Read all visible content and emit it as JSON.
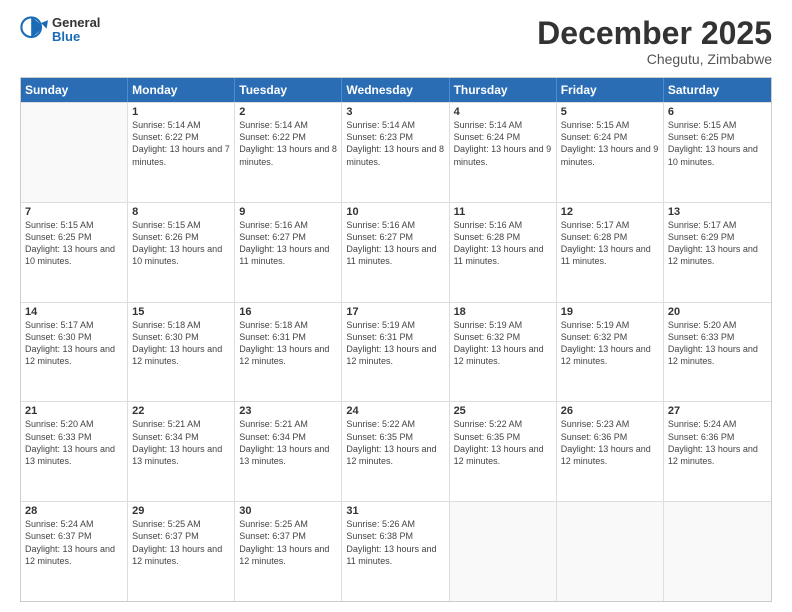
{
  "logo": {
    "general": "General",
    "blue": "Blue"
  },
  "header": {
    "month": "December 2025",
    "location": "Chegutu, Zimbabwe"
  },
  "days_of_week": [
    "Sunday",
    "Monday",
    "Tuesday",
    "Wednesday",
    "Thursday",
    "Friday",
    "Saturday"
  ],
  "weeks": [
    [
      {
        "day": "",
        "empty": true
      },
      {
        "day": "1",
        "sunrise": "Sunrise: 5:14 AM",
        "sunset": "Sunset: 6:22 PM",
        "daylight": "Daylight: 13 hours and 7 minutes."
      },
      {
        "day": "2",
        "sunrise": "Sunrise: 5:14 AM",
        "sunset": "Sunset: 6:22 PM",
        "daylight": "Daylight: 13 hours and 8 minutes."
      },
      {
        "day": "3",
        "sunrise": "Sunrise: 5:14 AM",
        "sunset": "Sunset: 6:23 PM",
        "daylight": "Daylight: 13 hours and 8 minutes."
      },
      {
        "day": "4",
        "sunrise": "Sunrise: 5:14 AM",
        "sunset": "Sunset: 6:24 PM",
        "daylight": "Daylight: 13 hours and 9 minutes."
      },
      {
        "day": "5",
        "sunrise": "Sunrise: 5:15 AM",
        "sunset": "Sunset: 6:24 PM",
        "daylight": "Daylight: 13 hours and 9 minutes."
      },
      {
        "day": "6",
        "sunrise": "Sunrise: 5:15 AM",
        "sunset": "Sunset: 6:25 PM",
        "daylight": "Daylight: 13 hours and 10 minutes."
      }
    ],
    [
      {
        "day": "7",
        "sunrise": "Sunrise: 5:15 AM",
        "sunset": "Sunset: 6:25 PM",
        "daylight": "Daylight: 13 hours and 10 minutes."
      },
      {
        "day": "8",
        "sunrise": "Sunrise: 5:15 AM",
        "sunset": "Sunset: 6:26 PM",
        "daylight": "Daylight: 13 hours and 10 minutes."
      },
      {
        "day": "9",
        "sunrise": "Sunrise: 5:16 AM",
        "sunset": "Sunset: 6:27 PM",
        "daylight": "Daylight: 13 hours and 11 minutes."
      },
      {
        "day": "10",
        "sunrise": "Sunrise: 5:16 AM",
        "sunset": "Sunset: 6:27 PM",
        "daylight": "Daylight: 13 hours and 11 minutes."
      },
      {
        "day": "11",
        "sunrise": "Sunrise: 5:16 AM",
        "sunset": "Sunset: 6:28 PM",
        "daylight": "Daylight: 13 hours and 11 minutes."
      },
      {
        "day": "12",
        "sunrise": "Sunrise: 5:17 AM",
        "sunset": "Sunset: 6:28 PM",
        "daylight": "Daylight: 13 hours and 11 minutes."
      },
      {
        "day": "13",
        "sunrise": "Sunrise: 5:17 AM",
        "sunset": "Sunset: 6:29 PM",
        "daylight": "Daylight: 13 hours and 12 minutes."
      }
    ],
    [
      {
        "day": "14",
        "sunrise": "Sunrise: 5:17 AM",
        "sunset": "Sunset: 6:30 PM",
        "daylight": "Daylight: 13 hours and 12 minutes."
      },
      {
        "day": "15",
        "sunrise": "Sunrise: 5:18 AM",
        "sunset": "Sunset: 6:30 PM",
        "daylight": "Daylight: 13 hours and 12 minutes."
      },
      {
        "day": "16",
        "sunrise": "Sunrise: 5:18 AM",
        "sunset": "Sunset: 6:31 PM",
        "daylight": "Daylight: 13 hours and 12 minutes."
      },
      {
        "day": "17",
        "sunrise": "Sunrise: 5:19 AM",
        "sunset": "Sunset: 6:31 PM",
        "daylight": "Daylight: 13 hours and 12 minutes."
      },
      {
        "day": "18",
        "sunrise": "Sunrise: 5:19 AM",
        "sunset": "Sunset: 6:32 PM",
        "daylight": "Daylight: 13 hours and 12 minutes."
      },
      {
        "day": "19",
        "sunrise": "Sunrise: 5:19 AM",
        "sunset": "Sunset: 6:32 PM",
        "daylight": "Daylight: 13 hours and 12 minutes."
      },
      {
        "day": "20",
        "sunrise": "Sunrise: 5:20 AM",
        "sunset": "Sunset: 6:33 PM",
        "daylight": "Daylight: 13 hours and 12 minutes."
      }
    ],
    [
      {
        "day": "21",
        "sunrise": "Sunrise: 5:20 AM",
        "sunset": "Sunset: 6:33 PM",
        "daylight": "Daylight: 13 hours and 13 minutes."
      },
      {
        "day": "22",
        "sunrise": "Sunrise: 5:21 AM",
        "sunset": "Sunset: 6:34 PM",
        "daylight": "Daylight: 13 hours and 13 minutes."
      },
      {
        "day": "23",
        "sunrise": "Sunrise: 5:21 AM",
        "sunset": "Sunset: 6:34 PM",
        "daylight": "Daylight: 13 hours and 13 minutes."
      },
      {
        "day": "24",
        "sunrise": "Sunrise: 5:22 AM",
        "sunset": "Sunset: 6:35 PM",
        "daylight": "Daylight: 13 hours and 12 minutes."
      },
      {
        "day": "25",
        "sunrise": "Sunrise: 5:22 AM",
        "sunset": "Sunset: 6:35 PM",
        "daylight": "Daylight: 13 hours and 12 minutes."
      },
      {
        "day": "26",
        "sunrise": "Sunrise: 5:23 AM",
        "sunset": "Sunset: 6:36 PM",
        "daylight": "Daylight: 13 hours and 12 minutes."
      },
      {
        "day": "27",
        "sunrise": "Sunrise: 5:24 AM",
        "sunset": "Sunset: 6:36 PM",
        "daylight": "Daylight: 13 hours and 12 minutes."
      }
    ],
    [
      {
        "day": "28",
        "sunrise": "Sunrise: 5:24 AM",
        "sunset": "Sunset: 6:37 PM",
        "daylight": "Daylight: 13 hours and 12 minutes."
      },
      {
        "day": "29",
        "sunrise": "Sunrise: 5:25 AM",
        "sunset": "Sunset: 6:37 PM",
        "daylight": "Daylight: 13 hours and 12 minutes."
      },
      {
        "day": "30",
        "sunrise": "Sunrise: 5:25 AM",
        "sunset": "Sunset: 6:37 PM",
        "daylight": "Daylight: 13 hours and 12 minutes."
      },
      {
        "day": "31",
        "sunrise": "Sunrise: 5:26 AM",
        "sunset": "Sunset: 6:38 PM",
        "daylight": "Daylight: 13 hours and 11 minutes."
      },
      {
        "day": "",
        "empty": true
      },
      {
        "day": "",
        "empty": true
      },
      {
        "day": "",
        "empty": true
      }
    ]
  ]
}
